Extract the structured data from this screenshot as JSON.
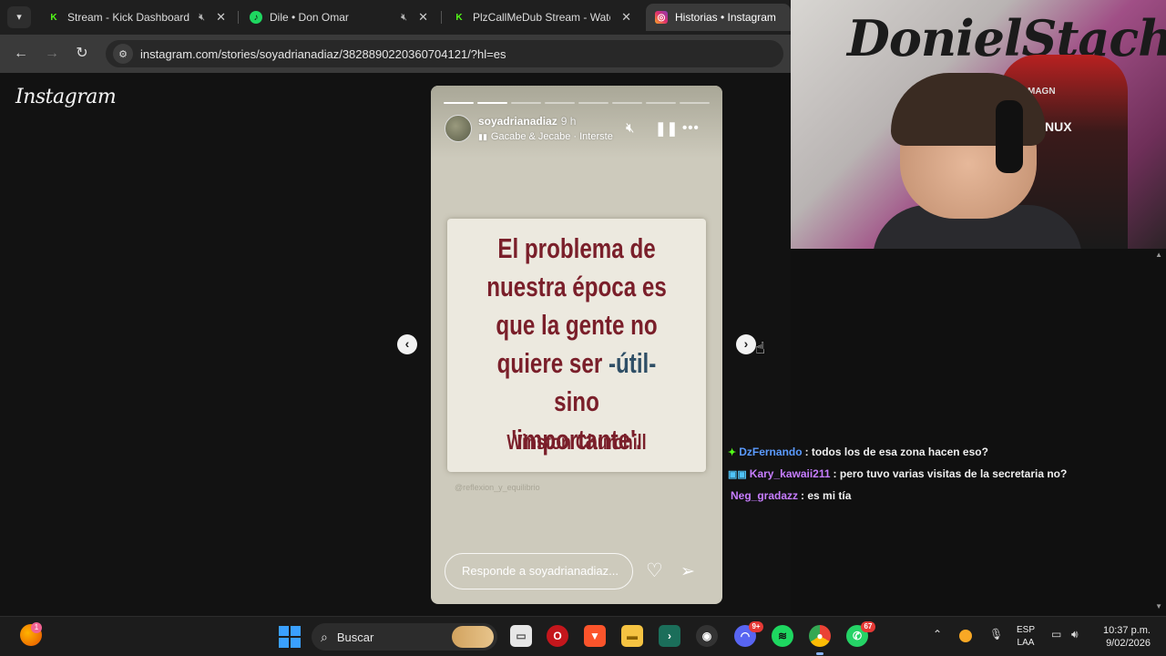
{
  "browser": {
    "tabs": [
      {
        "label": "Stream - Kick Dashboard",
        "favicon": "K",
        "favicon_color": "#53fc18",
        "muted": true
      },
      {
        "label": "Dile • Don Omar",
        "favicon": "♪",
        "favicon_color": "#1ed760",
        "muted": true
      },
      {
        "label": "PlzCallMeDub Stream - Watch L",
        "favicon": "K",
        "favicon_color": "#53fc18",
        "muted": false
      },
      {
        "label": "Historias • Instagram",
        "favicon": "◎",
        "favicon_color": "#e1306c",
        "active": true
      }
    ],
    "url": "instagram.com/stories/soyadrianadiaz/3828890220360704121/?hl=es"
  },
  "instagram": {
    "logo": "Instagram",
    "story": {
      "username": "soyadrianadiaz",
      "time": "9 h",
      "music": "Gacabe & Jecabe · Interste",
      "progress": {
        "segments": 8,
        "completed": 2
      },
      "quote_line1": "El problema de",
      "quote_line2": "nuestra época es",
      "quote_line3": "que la gente no",
      "quote_line4_a": "quiere ser ",
      "quote_line4_b": "-útil-",
      "quote_line4_c": " sino",
      "quote_line5": "'importante'.",
      "author": "Winston Churchill",
      "watermark": "@reflexion_y_equilibrio",
      "reply_placeholder": "Responde a soyadrianadiaz..."
    }
  },
  "webcam": {
    "graffiti": "DonielStach",
    "chair_brand": "AGNUX",
    "chair_brand_top": "MAGN"
  },
  "chat": {
    "messages": [
      {
        "badge": "✦",
        "badge_color": "#53fc18",
        "user": "DzFernando",
        "user_color": "#5b9bff",
        "text": ": todos los de esa zona hacen eso?"
      },
      {
        "badge": "▣▣",
        "badge_color": "#4fc3f7",
        "user": "Kary_kawaii211",
        "user_color": "#c77dff",
        "text": ": pero tuvo varias visitas de la secretaria no?"
      },
      {
        "badge": "",
        "badge_color": "#ffffff",
        "user": "Neg_gradazz",
        "user_color": "#c77dff",
        "text": ": es mi tía"
      }
    ]
  },
  "taskbar": {
    "weather_badge": "1",
    "search_label": "Buscar",
    "discord_badge": "9+",
    "whatsapp_badge": "67",
    "lang_line1": "ESP",
    "lang_line2": "LAA",
    "time": "10:37 p.m.",
    "date": "9/02/2026"
  }
}
